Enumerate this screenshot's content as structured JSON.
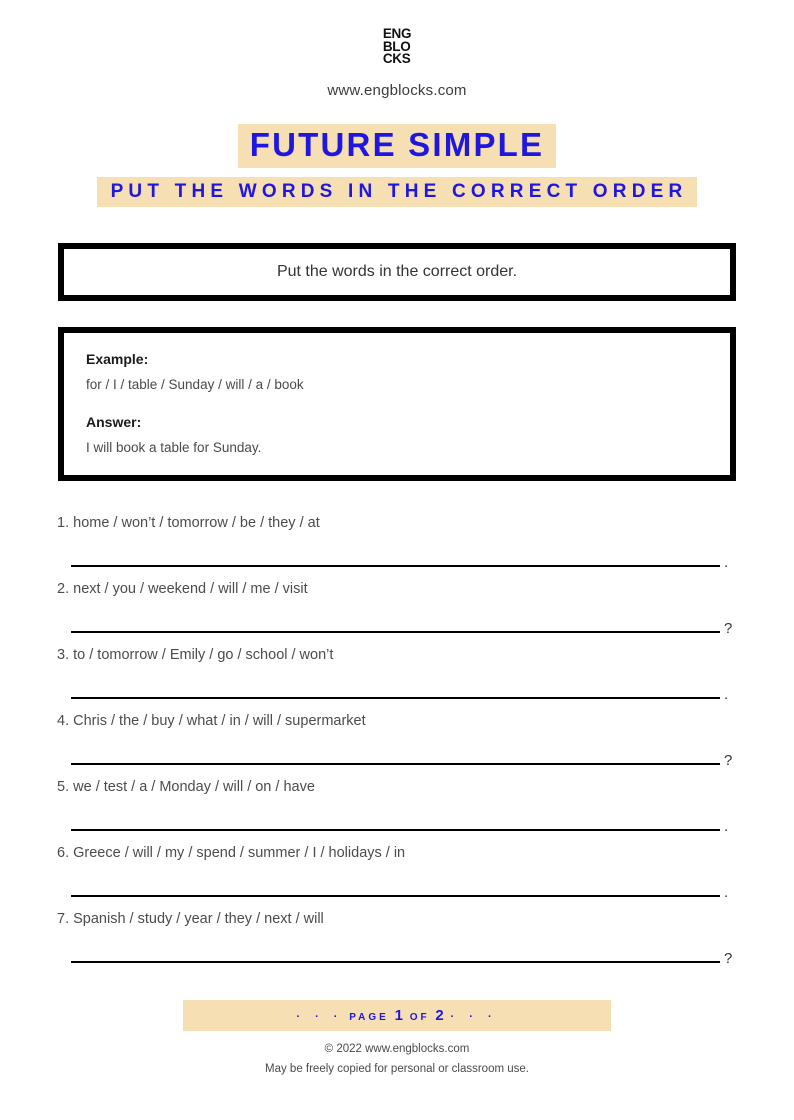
{
  "brand": {
    "logo_lines": [
      "ENG",
      "BLO",
      "CKS"
    ],
    "logo_name": "ENGBLOCKS",
    "url": "www.engblocks.com"
  },
  "header": {
    "title": "FUTURE SIMPLE",
    "subtitle": "PUT THE WORDS IN THE CORRECT ORDER"
  },
  "instruction": {
    "text": "Put the words in the correct order."
  },
  "example": {
    "example_label": "Example:",
    "example_text": "for / I / table / Sunday / will / a / book",
    "answer_label": "Answer:",
    "answer_text": "I will book a table for Sunday."
  },
  "exercise": {
    "items": [
      {
        "number": "1.",
        "prompt": "home / won’t / tomorrow / be / they / at",
        "punctuation": "."
      },
      {
        "number": "2.",
        "prompt": "next / you / weekend / will / me / visit",
        "punctuation": "?"
      },
      {
        "number": "3.",
        "prompt": "to / tomorrow / Emily / go / school / won’t",
        "punctuation": "."
      },
      {
        "number": "4.",
        "prompt": "Chris / the / buy / what / in / will / supermarket",
        "punctuation": "?"
      },
      {
        "number": "5.",
        "prompt": "we / test / a / Monday / will / on / have",
        "punctuation": "."
      },
      {
        "number": "6.",
        "prompt": "Greece / will / my / spend / summer / I / holidays / in",
        "punctuation": "."
      },
      {
        "number": "7.",
        "prompt": "Spanish / study / year / they / next / will",
        "punctuation": "?"
      }
    ]
  },
  "footer": {
    "dots_left": "·  ·  ·",
    "page_word": "PAGE",
    "page_number": "1",
    "of_word": "OF",
    "page_total": "2",
    "dots_right": "·  ·  ·",
    "copyright": "© 2022 www.engblocks.com",
    "license": "May be freely copied for personal or classroom use."
  },
  "colors": {
    "accent_blue": "#1f17e0",
    "highlight_tan": "#f6dfb2",
    "border_black": "#000000",
    "body_text": "#4c4c4c"
  }
}
